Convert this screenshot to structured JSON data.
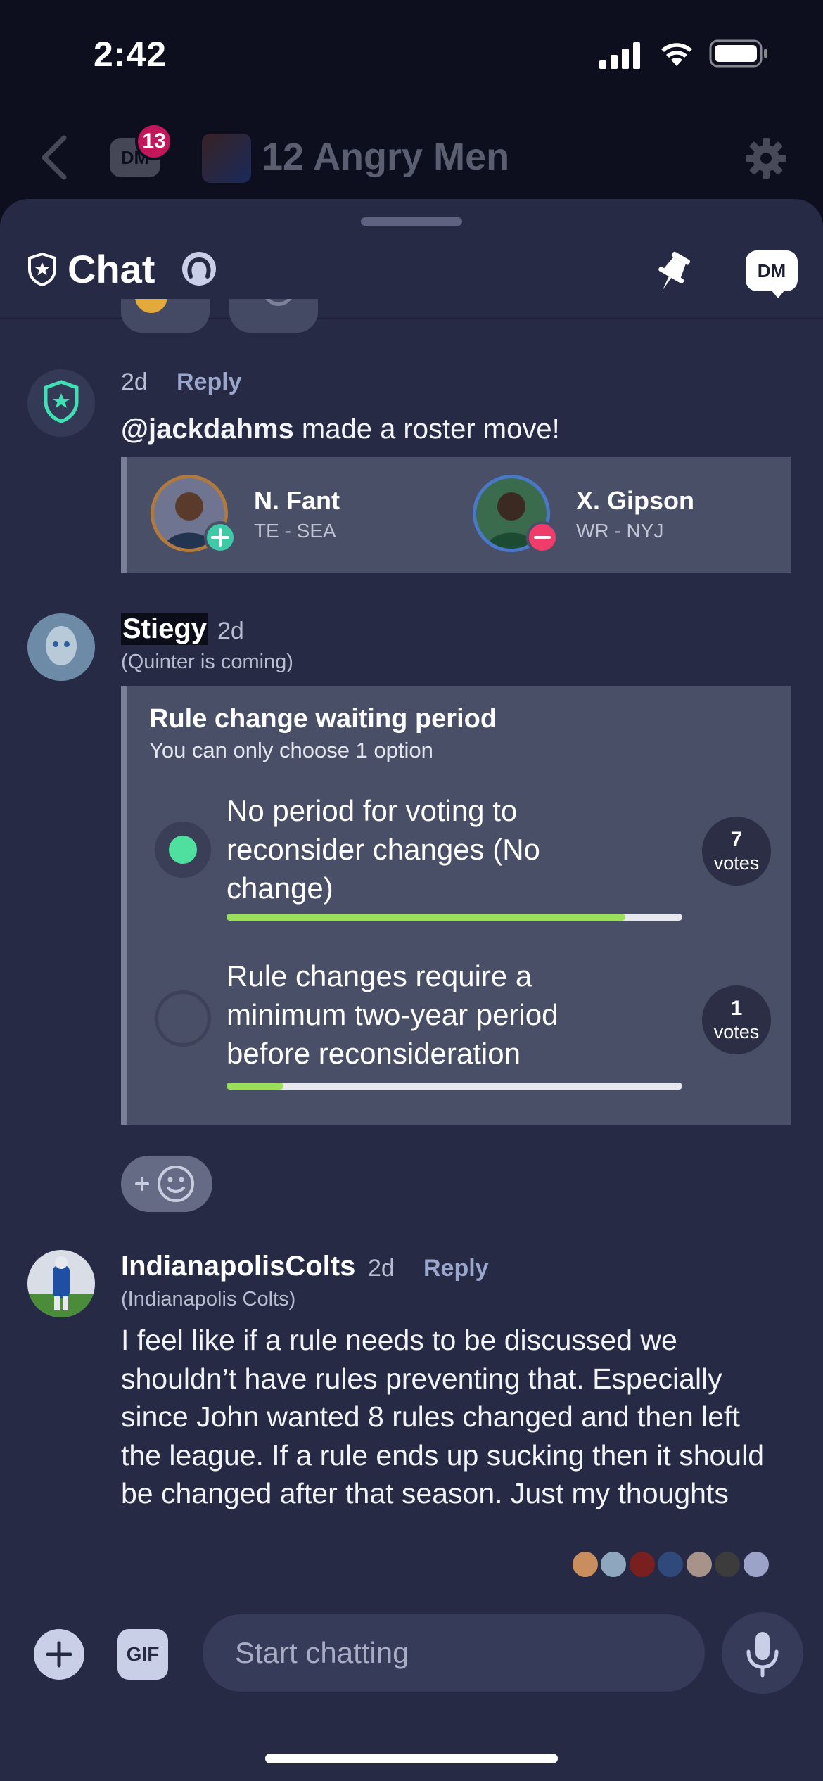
{
  "status_bar": {
    "time": "2:42"
  },
  "app_header": {
    "title": "12 Angry Men",
    "dm_badge_count": "13",
    "dm_label": "DM"
  },
  "chat_header": {
    "title": "Chat",
    "dm_label": "DM"
  },
  "messages": [
    {
      "time": "2d",
      "reply_label": "Reply",
      "mention": "@jackdahms",
      "text": " made a roster move!",
      "roster": {
        "added": {
          "name": "N. Fant",
          "position": "TE - SEA"
        },
        "dropped": {
          "name": "X. Gipson",
          "position": "WR - NYJ"
        }
      }
    },
    {
      "author": "Stiegy",
      "time": "2d",
      "team": "(Quinter is coming)",
      "poll": {
        "title": "Rule change waiting period",
        "subtitle": "You can only choose 1 option",
        "options": [
          {
            "text": "No period for voting to reconsider changes (No change)",
            "votes": "7",
            "votes_label": "votes",
            "share": 0.875,
            "selected": true
          },
          {
            "text": "Rule changes require a minimum two-year period before reconsideration",
            "votes": "1",
            "votes_label": "votes",
            "share": 0.125,
            "selected": false
          }
        ]
      }
    },
    {
      "author": "IndianapolisColts",
      "time": "2d",
      "reply_label": "Reply",
      "team": "(Indianapolis Colts)",
      "text": "I feel like if a rule needs to be discussed we shouldn’t have rules preventing that. Especially since John wanted 8 rules changed and then left the league. If a rule ends up sucking then it should be changed after that season. Just my thoughts"
    }
  ],
  "composer": {
    "placeholder": "Start chatting",
    "gif_label": "GIF"
  },
  "colors": {
    "sheet": "#262a45",
    "card": "#4a4f68",
    "accent_green": "#9be05a",
    "add_green": "#3ec9a7",
    "drop_red": "#ef3d6b",
    "badge": "#c2185b"
  }
}
